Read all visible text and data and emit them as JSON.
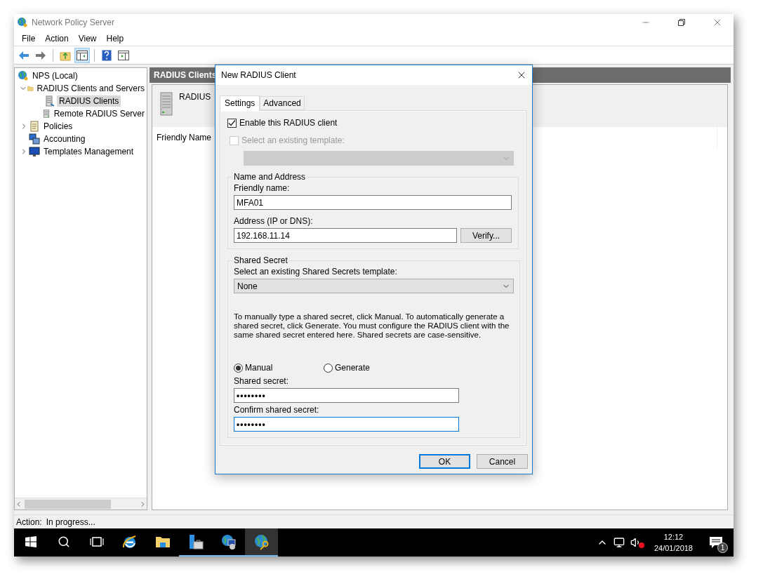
{
  "window": {
    "title": "Network Policy Server"
  },
  "menu": [
    "File",
    "Action",
    "View",
    "Help"
  ],
  "toolbar": [
    [
      {
        "kind": "back",
        "pressed": false
      },
      {
        "kind": "forward",
        "pressed": false
      }
    ],
    [
      {
        "kind": "up",
        "pressed": false
      },
      {
        "kind": "tree",
        "pressed": true
      }
    ],
    [
      {
        "kind": "help",
        "pressed": false
      },
      {
        "kind": "action-pane",
        "pressed": false
      }
    ]
  ],
  "tree": [
    {
      "label": "NPS (Local)",
      "kind": "root",
      "selected": false,
      "children": [
        {
          "label": "RADIUS Clients and Servers",
          "kind": "folder",
          "selected": false,
          "expanded": true,
          "children": [
            {
              "label": "RADIUS Clients",
              "kind": "clients",
              "selected": true
            },
            {
              "label": "Remote RADIUS Server",
              "kind": "servers",
              "selected": false
            }
          ]
        },
        {
          "label": "Policies",
          "kind": "policies",
          "selected": false,
          "expanded": false
        },
        {
          "label": "Accounting",
          "kind": "accounting",
          "selected": false
        },
        {
          "label": "Templates Management",
          "kind": "templates",
          "selected": false,
          "expanded": false
        }
      ]
    }
  ],
  "content": {
    "header": "RADIUS Clients",
    "heading": "RADIUS",
    "columns": [
      "Friendly Name"
    ]
  },
  "dialog": {
    "title": "New RADIUS Client",
    "tabs": [
      {
        "label": "Settings",
        "selected": true
      },
      {
        "label": "Advanced",
        "selected": false
      }
    ],
    "enable": {
      "label": "Enable this RADIUS client",
      "checked": true
    },
    "template": {
      "label": "Select an existing template:",
      "checked": false,
      "disabled": true
    },
    "name_group": {
      "title": "Name and Address",
      "friendly_label": "Friendly name:",
      "friendly_value": "MFA01",
      "address_label": "Address (IP or DNS):",
      "address_value": "192.168.11.14",
      "verify": "Verify..."
    },
    "secret_group": {
      "title": "Shared Secret",
      "template_label": "Select an existing Shared Secrets template:",
      "template_value": "None",
      "help": "To manually type a shared secret, click Manual. To automatically generate a shared secret, click Generate. You must configure the RADIUS client with the same shared secret entered here. Shared secrets are case-sensitive.",
      "modes": [
        {
          "label": "Manual",
          "selected": true
        },
        {
          "label": "Generate",
          "selected": false
        }
      ],
      "secret_label": "Shared secret:",
      "secret_value": "••••••••",
      "confirm_label": "Confirm shared secret:",
      "confirm_value": "••••••••",
      "confirm_focused": true
    },
    "buttons": [
      {
        "label": "OK",
        "default": true
      },
      {
        "label": "Cancel",
        "default": false
      }
    ]
  },
  "status": {
    "label": "Action:",
    "value": "In progress..."
  },
  "taskbar": {
    "apps": [
      {
        "kind": "start",
        "running": false,
        "selected": false
      },
      {
        "kind": "search",
        "running": false,
        "selected": false
      },
      {
        "kind": "task-view",
        "running": false,
        "selected": false
      },
      {
        "kind": "browser",
        "running": false,
        "selected": false
      },
      {
        "kind": "folder",
        "running": false,
        "selected": false
      },
      {
        "kind": "server-manager",
        "running": true,
        "selected": false
      },
      {
        "kind": "network",
        "running": true,
        "selected": false
      },
      {
        "kind": "nps",
        "running": true,
        "selected": true
      }
    ],
    "clock": {
      "time": "12:12",
      "date": "24/01/2018"
    },
    "notifications": "1"
  }
}
